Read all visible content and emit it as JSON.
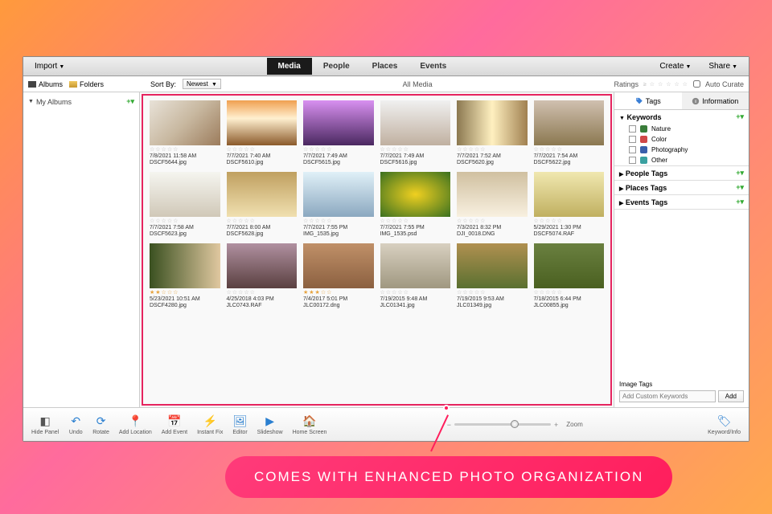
{
  "toolbar": {
    "import": "Import",
    "tabs": [
      "Media",
      "People",
      "Places",
      "Events"
    ],
    "active_tab": 0,
    "create": "Create",
    "share": "Share"
  },
  "sub": {
    "albums": "Albums",
    "folders": "Folders",
    "sortby": "Sort By:",
    "sort_value": "Newest",
    "all_media": "All Media",
    "ratings": "Ratings",
    "auto_curate": "Auto Curate"
  },
  "left": {
    "my_albums": "My Albums"
  },
  "right": {
    "tags_tab": "Tags",
    "info_tab": "Information",
    "keywords": "Keywords",
    "nature": "Nature",
    "color": "Color",
    "photography": "Photography",
    "other": "Other",
    "people_tags": "People Tags",
    "places_tags": "Places Tags",
    "events_tags": "Events Tags",
    "image_tags": "Image Tags",
    "add_placeholder": "Add Custom Keywords",
    "add_btn": "Add",
    "colors": {
      "nature": "#3a7d3a",
      "color": "#d04848",
      "photography": "#3a5fab",
      "other": "#3aa0a0"
    }
  },
  "bottom": {
    "hide_panel": "Hide Panel",
    "undo": "Undo",
    "rotate": "Rotate",
    "add_location": "Add Location",
    "add_event": "Add Event",
    "instant_fix": "Instant Fix",
    "editor": "Editor",
    "slideshow": "Slideshow",
    "home_screen": "Home Screen",
    "zoom": "Zoom",
    "keyword_info": "Keyword/Info"
  },
  "annotation": "COMES WITH ENHANCED PHOTO ORGANIZATION",
  "thumbs": [
    {
      "bg": "linear-gradient(135deg,#e8e2d8,#c8b8a0,#9c7c5c)",
      "stars": 0,
      "date": "7/8/2021 11:58 AM",
      "file": "DSCF5644.jpg"
    },
    {
      "bg": "linear-gradient(#f0a050,#fff0d0 40%,#8b5a2b)",
      "stars": 0,
      "date": "7/7/2021 7:40 AM",
      "file": "DSCF5610.jpg"
    },
    {
      "bg": "linear-gradient(#d890f0,#4a2860)",
      "stars": 0,
      "date": "7/7/2021 7:49 AM",
      "file": "DSCF5615.jpg"
    },
    {
      "bg": "linear-gradient(#f0f0f0,#c0b0a0)",
      "stars": 0,
      "date": "7/7/2021 7:49 AM",
      "file": "DSCF5616.jpg"
    },
    {
      "bg": "linear-gradient(90deg,#8b7850,#fff0c0,#a08050)",
      "stars": 0,
      "date": "7/7/2021 7:52 AM",
      "file": "DSCF5620.jpg"
    },
    {
      "bg": "linear-gradient(#d0c0b0,#8b7850)",
      "stars": 0,
      "date": "7/7/2021 7:54 AM",
      "file": "DSCF5622.jpg"
    },
    {
      "bg": "linear-gradient(#f5f5f0,#d0c8b8)",
      "stars": 0,
      "date": "7/7/2021 7:58 AM",
      "file": "DSCF5623.jpg"
    },
    {
      "bg": "linear-gradient(#c0a060,#f0e0b0)",
      "stars": 0,
      "date": "7/7/2021 8:00 AM",
      "file": "DSCF5628.jpg"
    },
    {
      "bg": "linear-gradient(#e0f0f8,#8ba8c0)",
      "stars": 0,
      "date": "7/7/2021 7:55 PM",
      "file": "IMG_1535.jpg"
    },
    {
      "bg": "radial-gradient(#f0d020,#3a7020)",
      "stars": 0,
      "date": "7/7/2021 7:55 PM",
      "file": "IMG_1535.psd"
    },
    {
      "bg": "linear-gradient(#d0c0a0,#f8f0e0)",
      "stars": 0,
      "date": "7/3/2021 8:32 PM",
      "file": "DJI_0018.DNG"
    },
    {
      "bg": "linear-gradient(#f0e8b0,#c0b060)",
      "stars": 0,
      "date": "5/29/2021 1:30 PM",
      "file": "DSCF5074.RAF"
    },
    {
      "bg": "linear-gradient(90deg,#3a5020,#e0c8a0)",
      "stars": 2,
      "date": "5/23/2021 10:51 AM",
      "file": "DSCF4280.jpg"
    },
    {
      "bg": "linear-gradient(#b090a0,#5a4040)",
      "stars": 0,
      "date": "4/25/2018 4:03 PM",
      "file": "JLC0743.RAF"
    },
    {
      "bg": "linear-gradient(#c09068,#8b6040)",
      "stars": 3,
      "date": "7/4/2017 5:01 PM",
      "file": "JLC00172.dng"
    },
    {
      "bg": "linear-gradient(#d8d0c0,#a09880)",
      "stars": 0,
      "date": "7/19/2015 9:48 AM",
      "file": "JLC01341.jpg"
    },
    {
      "bg": "linear-gradient(#b09050,#5a7030)",
      "stars": 0,
      "date": "7/19/2015 9:53 AM",
      "file": "JLC01349.jpg"
    },
    {
      "bg": "linear-gradient(#6a8040,#4a6020)",
      "stars": 0,
      "date": "7/18/2015 6:44 PM",
      "file": "JLC00855.jpg"
    }
  ]
}
